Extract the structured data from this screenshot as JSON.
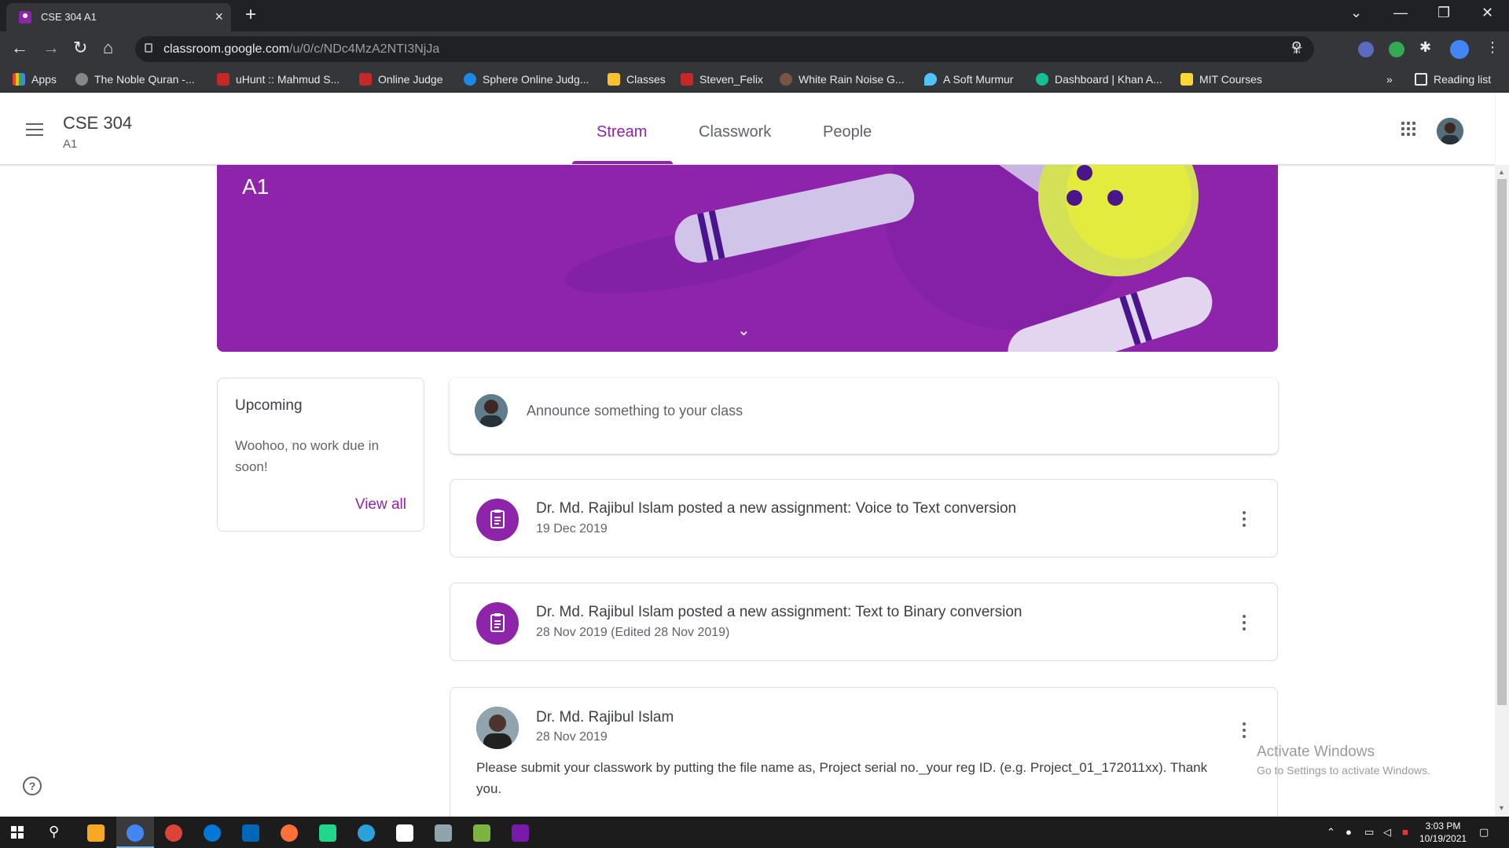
{
  "browser": {
    "tab_title": "CSE 304 A1",
    "url_host": "classroom.google.com",
    "url_path": "/u/0/c/NDc4MzA2NTI3NjJa",
    "bookmarks": [
      "Apps",
      "The Noble Quran -...",
      "uHunt :: Mahmud S...",
      "Online Judge",
      "Sphere Online Judg...",
      "Classes",
      "Steven_Felix",
      "White Rain Noise G...",
      "A Soft Murmur",
      "Dashboard | Khan A...",
      "MIT Courses"
    ],
    "reading_list": "Reading list",
    "more": "»"
  },
  "header": {
    "class_name": "CSE 304",
    "section": "A1",
    "tabs": [
      "Stream",
      "Classwork",
      "People"
    ],
    "active_tab": "Stream"
  },
  "banner": {
    "title": "A1",
    "color": "#8e24aa"
  },
  "upcoming": {
    "title": "Upcoming",
    "message": "Woohoo, no work due in soon!",
    "link": "View all"
  },
  "announce": {
    "placeholder": "Announce something to your class"
  },
  "posts": [
    {
      "title": "Dr. Md. Rajibul Islam posted a new assignment: Voice to Text conversion",
      "date": "19 Dec 2019"
    },
    {
      "title": "Dr. Md. Rajibul Islam posted a new assignment: Text to Binary conversion",
      "date": "28 Nov 2019 (Edited 28 Nov 2019)"
    }
  ],
  "message_post": {
    "author": "Dr. Md. Rajibul Islam",
    "date": "28 Nov 2019",
    "body": "Please submit your classwork by putting the file name as, Project serial no._your reg ID. (e.g. Project_01_172011xx). Thank you."
  },
  "help_label": "?",
  "watermark": {
    "line1": "Activate Windows",
    "line2": "Go to Settings to activate Windows."
  },
  "taskbar": {
    "time": "3:03 PM",
    "date": "10/19/2021"
  },
  "accent_color": "#8e24aa"
}
